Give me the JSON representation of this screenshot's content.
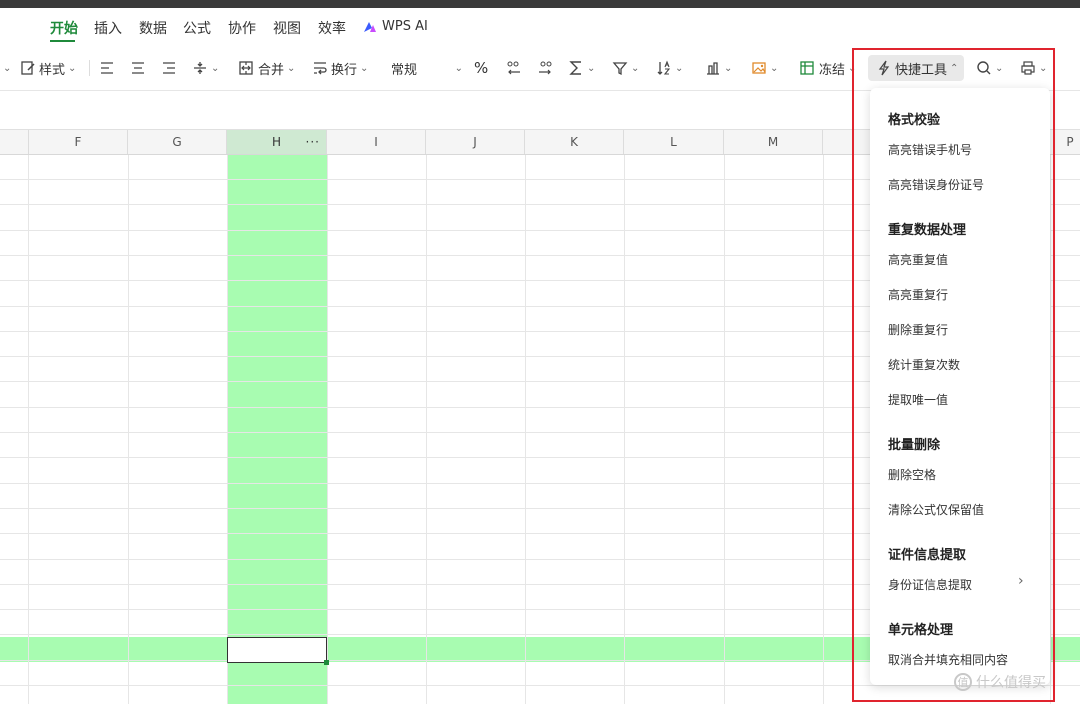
{
  "menu": {
    "tabs": [
      "开始",
      "插入",
      "数据",
      "公式",
      "协作",
      "视图",
      "效率"
    ],
    "wps_ai": "WPS AI"
  },
  "toolbar": {
    "style_label": "样式",
    "merge_label": "合并",
    "wrap_label": "换行",
    "number_format": "常规",
    "percent": "%",
    "freeze_label": "冻结",
    "quick_tools_label": "快捷工具",
    "chevron_down": "⌄",
    "chevron_up": "⌃"
  },
  "grid": {
    "columns": [
      "F",
      "G",
      "H",
      "I",
      "J",
      "K",
      "L",
      "M",
      "P"
    ],
    "selected_column": "H",
    "column_menu": "···"
  },
  "dropdown": {
    "sections": [
      {
        "title": "格式校验",
        "items": [
          "高亮错误手机号",
          "高亮错误身份证号"
        ]
      },
      {
        "title": "重复数据处理",
        "items": [
          "高亮重复值",
          "高亮重复行",
          "删除重复行",
          "统计重复次数",
          "提取唯一值"
        ]
      },
      {
        "title": "批量删除",
        "items": [
          "删除空格",
          "清除公式仅保留值"
        ]
      },
      {
        "title": "证件信息提取",
        "items": [
          "身份证信息提取"
        ]
      },
      {
        "title": "单元格处理",
        "items": [
          "取消合并填充相同内容"
        ]
      }
    ],
    "submenu_arrow": "›"
  },
  "watermark": {
    "text": "什么值得买",
    "icon": "值"
  },
  "colors": {
    "accent": "#1f8a3b",
    "highlight": "#a8fcb1",
    "annotation": "#e0242e"
  }
}
